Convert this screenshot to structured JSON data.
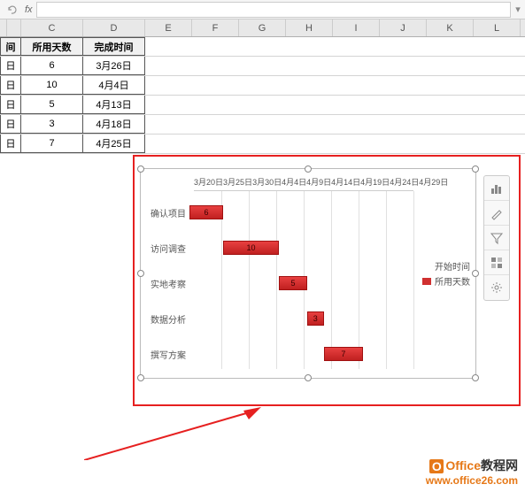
{
  "formula_bar": {
    "fx": "fx",
    "value": ""
  },
  "columns": [
    "C",
    "D",
    "E",
    "F",
    "G",
    "H",
    "I",
    "J",
    "K",
    "L"
  ],
  "table": {
    "header_b": "间",
    "header_c": "所用天数",
    "header_d": "完成时间",
    "rows": [
      {
        "b": "日",
        "c": "6",
        "d": "3月26日"
      },
      {
        "b": "日",
        "c": "10",
        "d": "4月4日"
      },
      {
        "b": "日",
        "c": "5",
        "d": "4月13日"
      },
      {
        "b": "日",
        "c": "3",
        "d": "4月18日"
      },
      {
        "b": "日",
        "c": "7",
        "d": "4月25日"
      }
    ]
  },
  "chart_data": {
    "type": "bar",
    "orientation": "horizontal",
    "stacked": true,
    "x_axis_labels": [
      "3月20日",
      "3月25日",
      "3月30日",
      "4月4日",
      "4月9日",
      "4月14日",
      "4月19日",
      "4月24日",
      "4月29日"
    ],
    "categories": [
      "确认项目",
      "访问调查",
      "实地考察",
      "数据分析",
      "撰写方案"
    ],
    "series": [
      {
        "name": "开始时间",
        "values": [
          "3月20日",
          "3月26日",
          "4月4日",
          "4月13日",
          "4月18日"
        ],
        "invisible": true
      },
      {
        "name": "所用天数",
        "values": [
          6,
          10,
          5,
          3,
          7
        ]
      }
    ],
    "legend": [
      "开始时间",
      "所用天数"
    ],
    "bar_color": "#d03030"
  },
  "chart_layout": [
    {
      "label": "确认项目",
      "left_pct": 0,
      "width_pct": 15,
      "val": "6"
    },
    {
      "label": "访问调查",
      "left_pct": 15,
      "width_pct": 25,
      "val": "10"
    },
    {
      "label": "实地考察",
      "left_pct": 40,
      "width_pct": 12.5,
      "val": "5"
    },
    {
      "label": "数据分析",
      "left_pct": 52.5,
      "width_pct": 7.5,
      "val": "3"
    },
    {
      "label": "撰写方案",
      "left_pct": 60,
      "width_pct": 17.5,
      "val": "7"
    }
  ],
  "side_tools": [
    "chart-element-icon",
    "brush-icon",
    "filter-icon",
    "chart-type-icon",
    "settings-icon"
  ],
  "watermark": {
    "line1a": "Office",
    "line1b": "教程网",
    "line2": "www.office26.com",
    "badge": "O"
  }
}
